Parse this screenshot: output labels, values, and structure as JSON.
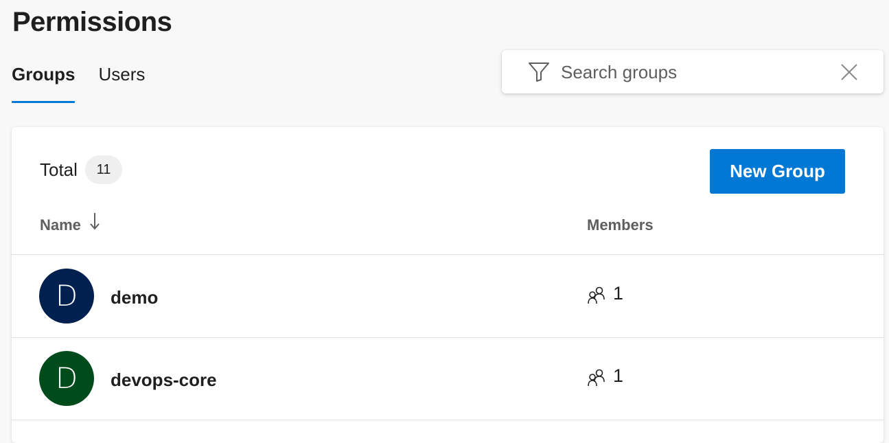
{
  "page": {
    "title": "Permissions"
  },
  "tabs": [
    {
      "label": "Groups",
      "active": true
    },
    {
      "label": "Users",
      "active": false
    }
  ],
  "search": {
    "placeholder": "Search groups",
    "value": "",
    "filter_icon": "filter-icon",
    "clear_icon": "close-icon"
  },
  "summary": {
    "total_label": "Total",
    "total_count": "11"
  },
  "toolbar": {
    "new_group_label": "New Group"
  },
  "table": {
    "columns": {
      "name": "Name",
      "members": "Members"
    },
    "sort": {
      "column": "name",
      "direction": "descending",
      "icon": "arrow-down-icon"
    },
    "rows": [
      {
        "initial": "D",
        "name": "demo",
        "members": "1",
        "avatar_color": "#002050"
      },
      {
        "initial": "D",
        "name": "devops-core",
        "members": "1",
        "avatar_color": "#004b1c"
      }
    ]
  },
  "colors": {
    "accent": "#0078d4",
    "background": "#f8f8f8",
    "card": "#ffffff"
  }
}
